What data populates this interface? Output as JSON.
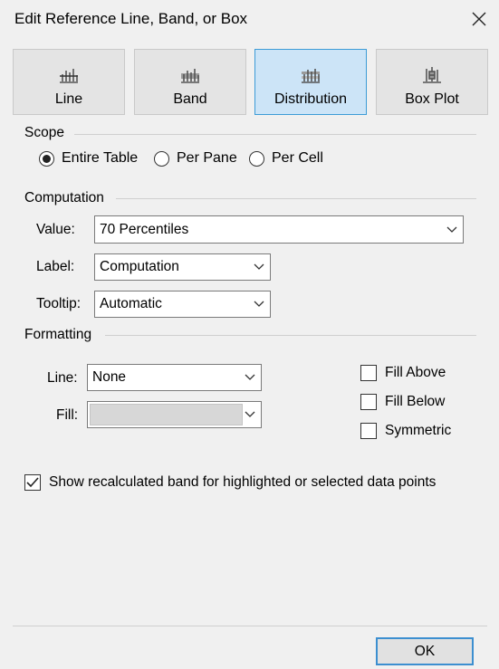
{
  "window": {
    "title": "Edit Reference Line, Band, or Box"
  },
  "type_buttons": [
    {
      "label": "Line",
      "icon": "line-chart-icon",
      "selected": false
    },
    {
      "label": "Band",
      "icon": "band-chart-icon",
      "selected": false
    },
    {
      "label": "Distribution",
      "icon": "distribution-chart-icon",
      "selected": true
    },
    {
      "label": "Box Plot",
      "icon": "box-plot-icon",
      "selected": false
    }
  ],
  "scope": {
    "heading": "Scope",
    "options": [
      {
        "label": "Entire Table",
        "selected": true
      },
      {
        "label": "Per Pane",
        "selected": false
      },
      {
        "label": "Per Cell",
        "selected": false
      }
    ]
  },
  "computation": {
    "heading": "Computation",
    "value_label": "Value:",
    "value": "70 Percentiles",
    "label_label": "Label:",
    "label_value": "Computation",
    "tooltip_label": "Tooltip:",
    "tooltip_value": "Automatic"
  },
  "formatting": {
    "heading": "Formatting",
    "line_label": "Line:",
    "line_value": "None",
    "fill_label": "Fill:",
    "fill_value": "",
    "fill_above": {
      "label": "Fill Above",
      "checked": false
    },
    "fill_below": {
      "label": "Fill Below",
      "checked": false
    },
    "symmetric": {
      "label": "Symmetric",
      "checked": false
    }
  },
  "recalc": {
    "label": "Show recalculated band for highlighted or selected data points",
    "checked": true
  },
  "footer": {
    "ok_label": "OK"
  },
  "colors": {
    "selected_bg": "#cce4f7",
    "selected_border": "#3c9bd6",
    "dialog_bg": "#f0f0f0"
  }
}
